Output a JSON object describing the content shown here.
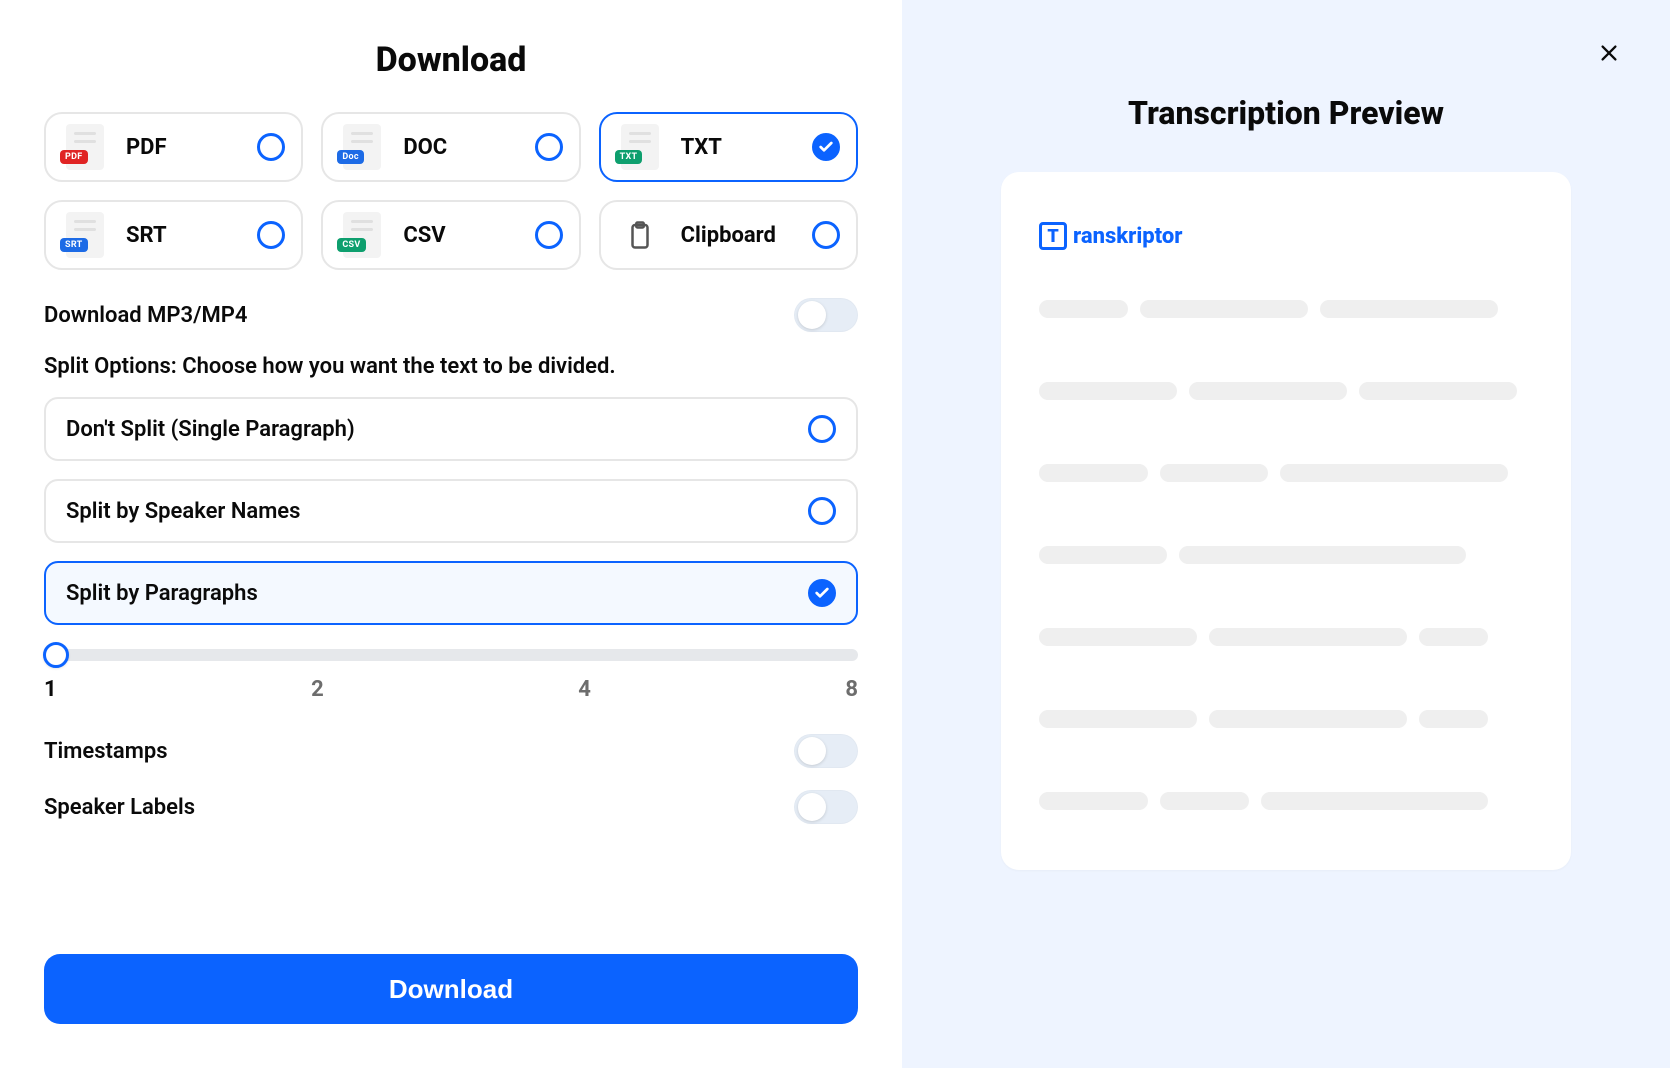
{
  "left": {
    "title": "Download",
    "formats": [
      {
        "id": "pdf",
        "label": "PDF",
        "tag": "PDF",
        "tagClass": "tag-pdf",
        "selected": false
      },
      {
        "id": "doc",
        "label": "DOC",
        "tag": "Doc",
        "tagClass": "tag-doc",
        "selected": false
      },
      {
        "id": "txt",
        "label": "TXT",
        "tag": "TXT",
        "tagClass": "tag-txt",
        "selected": true
      },
      {
        "id": "srt",
        "label": "SRT",
        "tag": "SRT",
        "tagClass": "tag-srt",
        "selected": false
      },
      {
        "id": "csv",
        "label": "CSV",
        "tag": "CSV",
        "tagClass": "tag-csv",
        "selected": false
      },
      {
        "id": "clipboard",
        "label": "Clipboard",
        "tag": "",
        "tagClass": "",
        "selected": false
      }
    ],
    "media_toggle": {
      "label": "Download MP3/MP4",
      "enabled": false
    },
    "split_section_text": "Split Options: Choose how you want the text to be divided.",
    "split_options": [
      {
        "label": "Don't Split (Single Paragraph)",
        "selected": false
      },
      {
        "label": "Split by Speaker Names",
        "selected": false
      },
      {
        "label": "Split by Paragraphs",
        "selected": true
      }
    ],
    "slider": {
      "value": 1,
      "ticks": [
        "1",
        "2",
        "4",
        "8"
      ]
    },
    "timestamps": {
      "label": "Timestamps",
      "enabled": false
    },
    "speaker_labels": {
      "label": "Speaker Labels",
      "enabled": false
    },
    "download_button": "Download"
  },
  "right": {
    "title": "Transcription Preview",
    "brand": "ranskriptor",
    "brand_letter": "T"
  }
}
